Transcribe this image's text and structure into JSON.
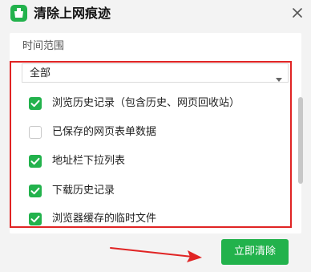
{
  "window": {
    "title": "清除上网痕迹",
    "app_icon": "broom-icon",
    "close_icon": "close-icon"
  },
  "time_range": {
    "label": "时间范围",
    "selected": "全部"
  },
  "options": [
    {
      "label": "浏览历史记录（包含历史、网页回收站）",
      "checked": true
    },
    {
      "label": "已保存的网页表单数据",
      "checked": false
    },
    {
      "label": "地址栏下拉列表",
      "checked": true
    },
    {
      "label": "下载历史记录",
      "checked": true
    },
    {
      "label": "浏览器缓存的临时文件",
      "checked": true
    }
  ],
  "actions": {
    "clear_now": "立即清除"
  },
  "colors": {
    "accent": "#22b24c",
    "highlight": "#e02424",
    "panel": "#ffffff",
    "background": "#f3f3f3"
  }
}
